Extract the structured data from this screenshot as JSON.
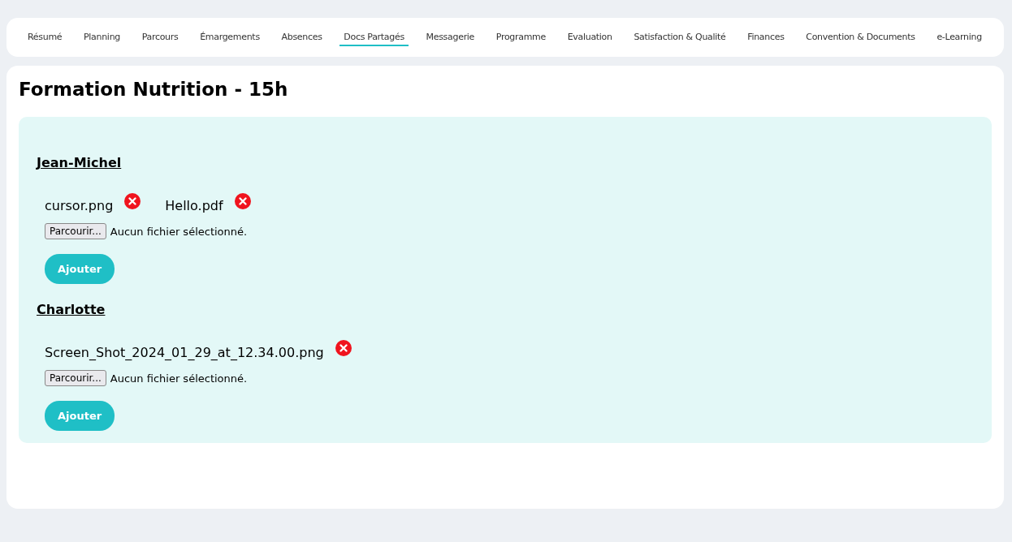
{
  "tabs": [
    {
      "label": "Résumé",
      "selected": false
    },
    {
      "label": "Planning",
      "selected": false
    },
    {
      "label": "Parcours",
      "selected": false
    },
    {
      "label": "Émargements",
      "selected": false
    },
    {
      "label": "Absences",
      "selected": false
    },
    {
      "label": "Docs Partagés",
      "selected": true
    },
    {
      "label": "Messagerie",
      "selected": false
    },
    {
      "label": "Programme",
      "selected": false
    },
    {
      "label": "Evaluation",
      "selected": false
    },
    {
      "label": "Satisfaction & Qualité",
      "selected": false
    },
    {
      "label": "Finances",
      "selected": false
    },
    {
      "label": "Convention & Documents",
      "selected": false
    },
    {
      "label": "e-Learning",
      "selected": false
    }
  ],
  "title": "Formation Nutrition - 15h",
  "learners": [
    {
      "name": "Jean-Michel",
      "files": [
        "cursor.png",
        "Hello.pdf"
      ],
      "browse_button": "Parcourir...",
      "file_status": "Aucun fichier sélectionné.",
      "add_button": "Ajouter"
    },
    {
      "name": "Charlotte",
      "files": [
        "Screen_Shot_2024_01_29_at_12.34.00.png"
      ],
      "browse_button": "Parcourir...",
      "file_status": "Aucun fichier sélectionné.",
      "add_button": "Ajouter"
    }
  ]
}
